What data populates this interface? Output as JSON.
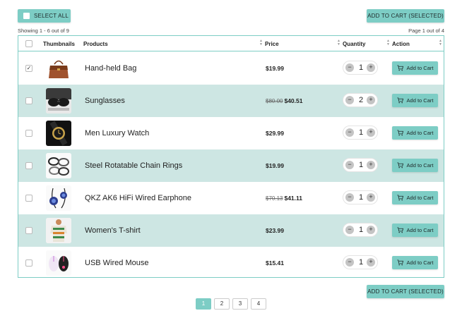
{
  "toolbar": {
    "select_all_label": "SELECT ALL",
    "add_selected_label": "ADD TO CART (SELECTED)"
  },
  "summary": {
    "showing": "Showing 1 - 6 out of 9",
    "page": "Page 1 out of 4"
  },
  "table": {
    "headers": {
      "thumbnails": "Thumbnails",
      "products": "Products",
      "price": "Price",
      "quantity": "Quantity",
      "action": "Action"
    },
    "rows": [
      {
        "name": "Hand-held Bag",
        "old_price": "",
        "price": "$19.99",
        "qty": "1",
        "checked": true,
        "action": "Add to Cart"
      },
      {
        "name": "Sunglasses",
        "old_price": "$80.00",
        "price": "$40.51",
        "qty": "2",
        "checked": false,
        "action": "Add to Cart"
      },
      {
        "name": "Men Luxury Watch",
        "old_price": "",
        "price": "$29.99",
        "qty": "1",
        "checked": false,
        "action": "Add to Cart"
      },
      {
        "name": "Steel Rotatable Chain Rings",
        "old_price": "",
        "price": "$19.99",
        "qty": "1",
        "checked": false,
        "action": "Add to Cart"
      },
      {
        "name": "QKZ AK6 HiFi Wired Earphone",
        "old_price": "$70.13",
        "price": "$41.11",
        "qty": "1",
        "checked": false,
        "action": "Add to Cart"
      },
      {
        "name": "Women's T-shirt",
        "old_price": "",
        "price": "$23.99",
        "qty": "1",
        "checked": false,
        "action": "Add to Cart"
      },
      {
        "name": "USB Wired Mouse",
        "old_price": "",
        "price": "$15.41",
        "qty": "1",
        "checked": false,
        "action": "Add to Cart"
      }
    ]
  },
  "pagination": {
    "pages": [
      "1",
      "2",
      "3",
      "4"
    ],
    "current": "1"
  },
  "colors": {
    "accent": "#7dcdc5",
    "row_alt": "#cde6e3"
  }
}
